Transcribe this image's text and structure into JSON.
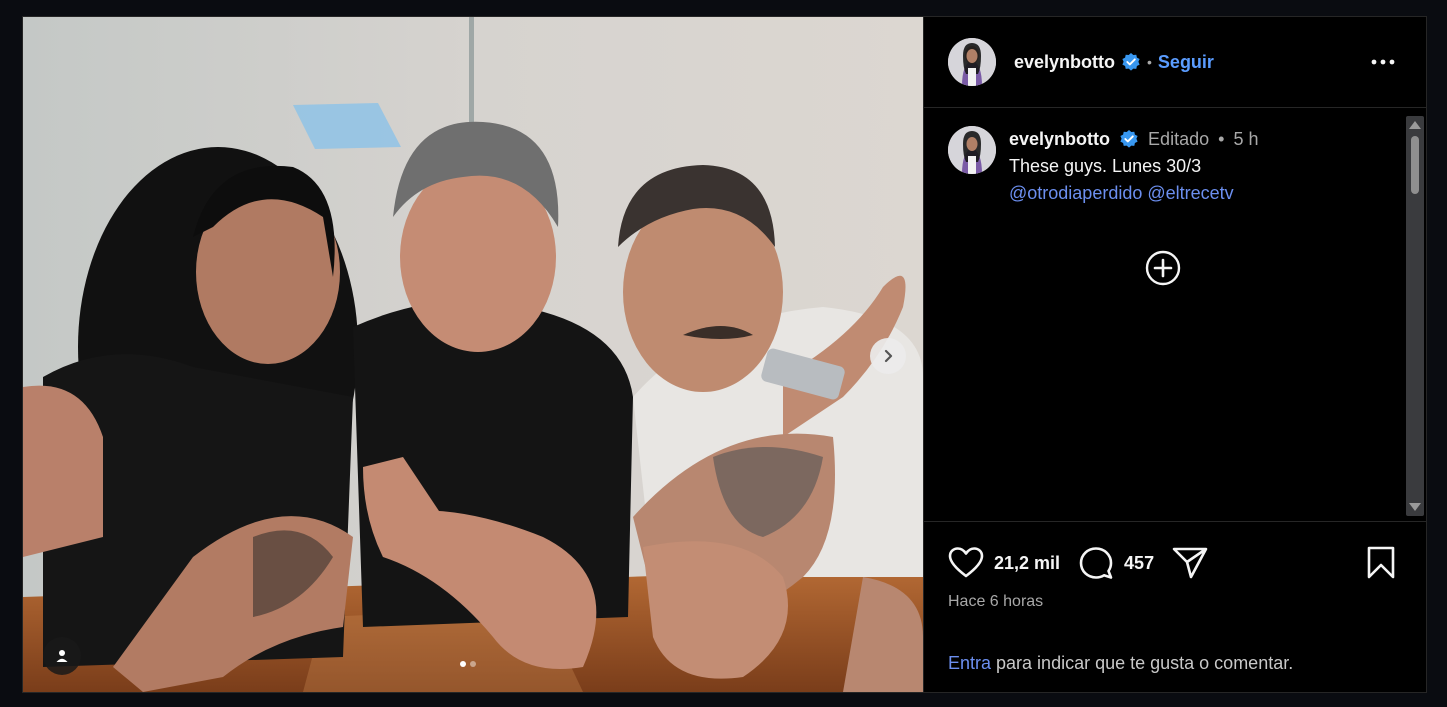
{
  "post": {
    "username": "evelynbotto",
    "follow_label": "Seguir",
    "separator": "•",
    "caption": {
      "username": "evelynbotto",
      "edited": "Editado",
      "dot": "•",
      "age": "5 h",
      "text": "These guys. Lunes 30/3",
      "mentions": [
        "@otrodiaperdido",
        "@eltrecetv"
      ]
    },
    "carousel": {
      "current": 1,
      "total": 2
    }
  },
  "actions": {
    "likes": "21,2 mil",
    "comments": "457"
  },
  "timestamp": "Hace 6 horas",
  "login_prompt": {
    "link": "Entra",
    "text": " para indicar que te gusta o comentar."
  },
  "icons": {
    "verified": "verified-badge-icon",
    "more": "more-options-icon",
    "next": "chevron-right-icon",
    "user_tag": "user-tag-icon",
    "add": "plus-circle-icon",
    "like": "heart-icon",
    "comment": "comment-bubble-icon",
    "share": "paper-plane-icon",
    "save": "bookmark-icon"
  },
  "colors": {
    "accent_link": "#5a9cff",
    "mention": "#6c8ff0",
    "verified": "#3897f0"
  }
}
